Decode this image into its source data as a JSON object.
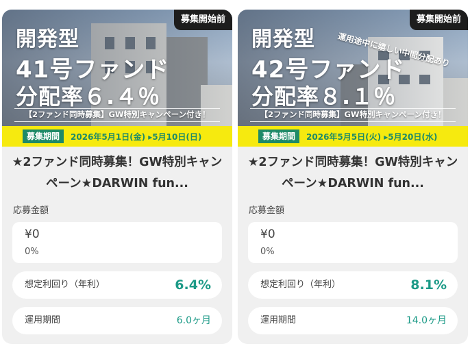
{
  "cards": [
    {
      "status": "募集開始前",
      "hero_line1": "開発型",
      "hero_line2": "41号ファンド",
      "hero_line3": "分配率６.４％",
      "hero_note": "",
      "campaign": "【2ファンド同時募集】GW特別キャンペーン付き！",
      "period_badge": "募集期間",
      "period_dates": "2026年5月1日(金) ▸5月10日(日)",
      "title": "★2ファンド同時募集！GW特別キャンペーン★DARWIN fun...",
      "amount_label": "応募金額",
      "amount_value": "¥0",
      "amount_percent": "0%",
      "yield_label": "想定利回り（年利）",
      "yield_value": "6.4%",
      "term_label": "運用期間",
      "term_value": "6.0ヶ月"
    },
    {
      "status": "募集開始前",
      "hero_line1": "開発型",
      "hero_line2": "42号ファンド",
      "hero_line3": "分配率８.１％",
      "hero_note": "運用途中に嬉しい中間分配あり",
      "campaign": "【2ファンド同時募集】GW特別キャンペーン付き！",
      "period_badge": "募集期間",
      "period_dates": "2026年5月5日(火) ▸5月20日(水)",
      "title": "★2ファンド同時募集！GW特別キャンペーン★DARWIN fun...",
      "amount_label": "応募金額",
      "amount_value": "¥0",
      "amount_percent": "0%",
      "yield_label": "想定利回り（年利）",
      "yield_value": "8.1%",
      "term_label": "運用期間",
      "term_value": "14.0ヶ月"
    }
  ],
  "colors": {
    "accent": "#1c9a87",
    "period_bg": "#f6ea0f",
    "badge_bg": "#1e8a68",
    "card_bg": "#f0f0f0"
  }
}
